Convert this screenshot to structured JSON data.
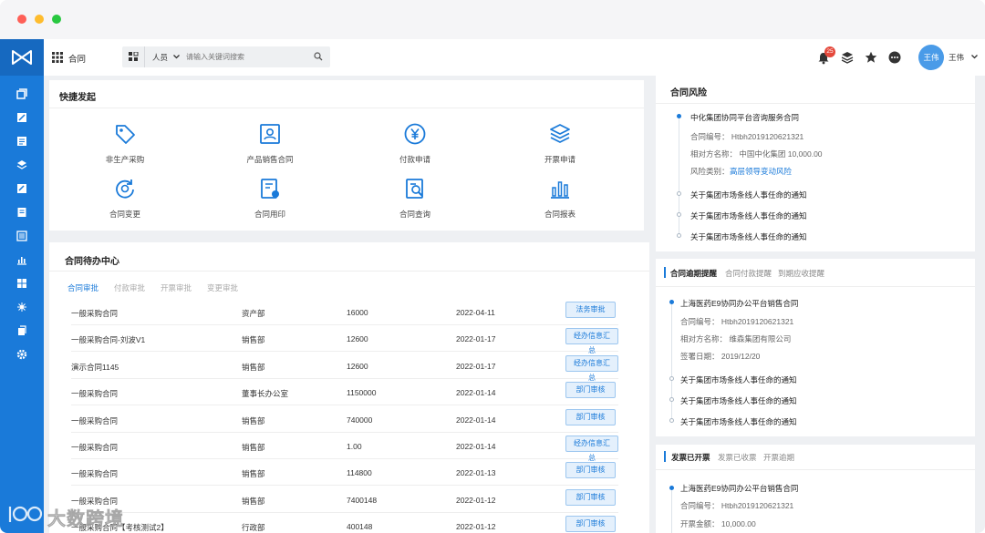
{
  "topbar": {
    "app_title": "合同",
    "filter_label": "人员",
    "search_placeholder": "请输入关键词搜索",
    "notification_count": "25",
    "user_avatar_text": "王伟",
    "user_name": "王伟"
  },
  "quick_start": {
    "title": "快捷发起",
    "items": [
      {
        "label": "非生产采购",
        "icon": "tag-icon"
      },
      {
        "label": "产品销售合同",
        "icon": "contact-card-icon"
      },
      {
        "label": "付款申请",
        "icon": "yen-coin-icon"
      },
      {
        "label": "开票申请",
        "icon": "layers-icon"
      },
      {
        "label": "合同变更",
        "icon": "change-cycle-icon"
      },
      {
        "label": "合同用印",
        "icon": "seal-document-icon"
      },
      {
        "label": "合同查询",
        "icon": "search-document-icon"
      },
      {
        "label": "合同报表",
        "icon": "bar-report-icon"
      }
    ]
  },
  "todo": {
    "title": "合同待办中心",
    "tabs": [
      "合同审批",
      "付款审批",
      "开票审批",
      "变更审批"
    ],
    "active_tab": 0,
    "rows": [
      {
        "name": "一般采购合同",
        "dept": "资产部",
        "amount": "16000",
        "date": "2022-04-11",
        "action": "法务审批"
      },
      {
        "name": "一般采购合同-刘波V1",
        "dept": "销售部",
        "amount": "12600",
        "date": "2022-01-17",
        "action": "经办信息汇总"
      },
      {
        "name": "演示合同1145",
        "dept": "销售部",
        "amount": "12600",
        "date": "2022-01-17",
        "action": "经办信息汇总"
      },
      {
        "name": "一般采购合同",
        "dept": "董事长办公室",
        "amount": "1150000",
        "date": "2022-01-14",
        "action": "部门审核"
      },
      {
        "name": "一般采购合同",
        "dept": "销售部",
        "amount": "740000",
        "date": "2022-01-14",
        "action": "部门审核"
      },
      {
        "name": "一般采购合同",
        "dept": "销售部",
        "amount": "1.00",
        "date": "2022-01-14",
        "action": "经办信息汇总"
      },
      {
        "name": "一般采购合同",
        "dept": "销售部",
        "amount": "114800",
        "date": "2022-01-13",
        "action": "部门审核"
      },
      {
        "name": "一般采购合同",
        "dept": "销售部",
        "amount": "7400148",
        "date": "2022-01-12",
        "action": "部门审核"
      },
      {
        "name": "一般采购合同【考核测试2】",
        "dept": "行政部",
        "amount": "400148",
        "date": "2022-01-12",
        "action": "部门审核"
      }
    ]
  },
  "risk": {
    "title": "合同风险",
    "first": {
      "title": "中化集团协同平台咨询服务合同",
      "contract_no": "合同编号： Htbh2019120621321",
      "party": "相对方名称： 中国中化集团 10,000.00",
      "risk_type_label": "风险类别：",
      "risk_type_value": "高层领导变动风险"
    },
    "others": [
      "关于集团市场条线人事任命的通知",
      "关于集团市场条线人事任命的通知",
      "关于集团市场条线人事任命的通知"
    ]
  },
  "overdue": {
    "tabs": [
      "合同逾期提醒",
      "合同付款提醒",
      "到期应收提醒"
    ],
    "active_tab": 0,
    "first": {
      "title": "上海医药E9协同办公平台销售合同",
      "contract_no": "合同编号： Htbh2019120621321",
      "party": "相对方名称： 维森集团有限公司",
      "sign_date": "签署日期： 2019/12/20"
    },
    "others": [
      "关于集团市场条线人事任命的通知",
      "关于集团市场条线人事任命的通知",
      "关于集团市场条线人事任命的通知"
    ]
  },
  "invoice": {
    "tabs": [
      "发票已开票",
      "发票已收票",
      "开票逾期"
    ],
    "active_tab": 0,
    "first": {
      "title": "上海医药E9协同办公平台销售合同",
      "contract_no": "合同编号： Htbh2019120621321",
      "amount": "开票金额： 10,000.00"
    }
  },
  "watermark": "大数跨境",
  "colors": {
    "brand": "#1a7ad9",
    "badge": "#e5483b",
    "dot_red": "#fe5f57",
    "dot_yellow": "#febc2e",
    "dot_green": "#28c840"
  }
}
